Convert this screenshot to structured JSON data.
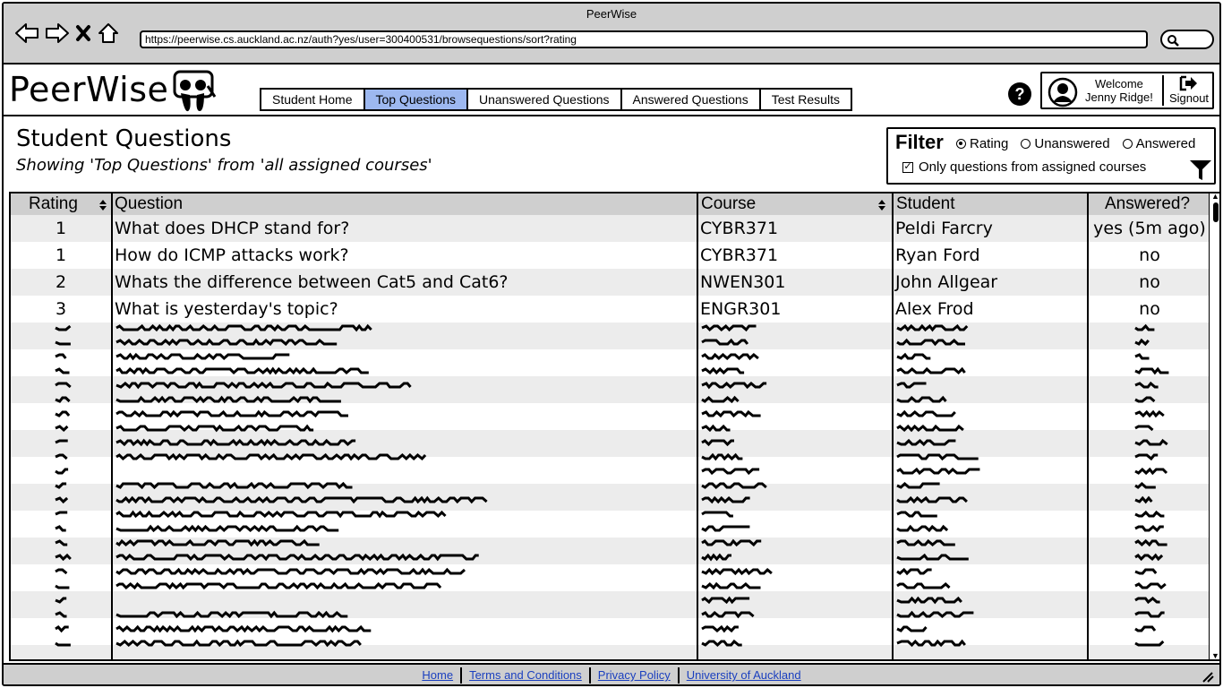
{
  "browser": {
    "title": "PeerWise",
    "url": "https://peerwise.cs.auckland.ac.nz/auth?yes/user=300400531/browsequestions/sort?rating"
  },
  "header": {
    "logo": "PeerWise",
    "tabs": [
      {
        "label": "Student Home",
        "active": false
      },
      {
        "label": "Top Questions",
        "active": true
      },
      {
        "label": "Unanswered Questions",
        "active": false
      },
      {
        "label": "Answered Questions",
        "active": false
      },
      {
        "label": "Test Results",
        "active": false
      }
    ],
    "user": {
      "welcome": "Welcome",
      "name": "Jenny Ridge!",
      "signout": "Signout"
    }
  },
  "page": {
    "title": "Student Questions",
    "subtitle": "Showing 'Top Questions' from 'all assigned courses'"
  },
  "filter": {
    "title": "Filter",
    "options": [
      "Rating",
      "Unanswered",
      "Answered"
    ],
    "selected": "Rating",
    "checkbox_label": "Only questions from assigned courses",
    "checkbox_checked": true
  },
  "table": {
    "columns": [
      "Rating",
      "Question",
      "Course",
      "Student",
      "Answered?"
    ],
    "rows": [
      {
        "rating": "1",
        "question": "What does DHCP stand for?",
        "course": "CYBR371",
        "student": "Peldi Farcry",
        "answered": "yes (5m ago)"
      },
      {
        "rating": "1",
        "question": "How do ICMP attacks work?",
        "course": "CYBR371",
        "student": "Ryan Ford",
        "answered": "no"
      },
      {
        "rating": "2",
        "question": "Whats the difference between Cat5 and Cat6?",
        "course": "NWEN301",
        "student": "John Allgear",
        "answered": "no"
      },
      {
        "rating": "3",
        "question": "What is yesterday's topic?",
        "course": "ENGR301",
        "student": "Alex Frod",
        "answered": "no"
      }
    ]
  },
  "footer": {
    "links": [
      "Home",
      "Terms and Conditions",
      "Privacy Policy",
      "University of Auckland"
    ]
  }
}
